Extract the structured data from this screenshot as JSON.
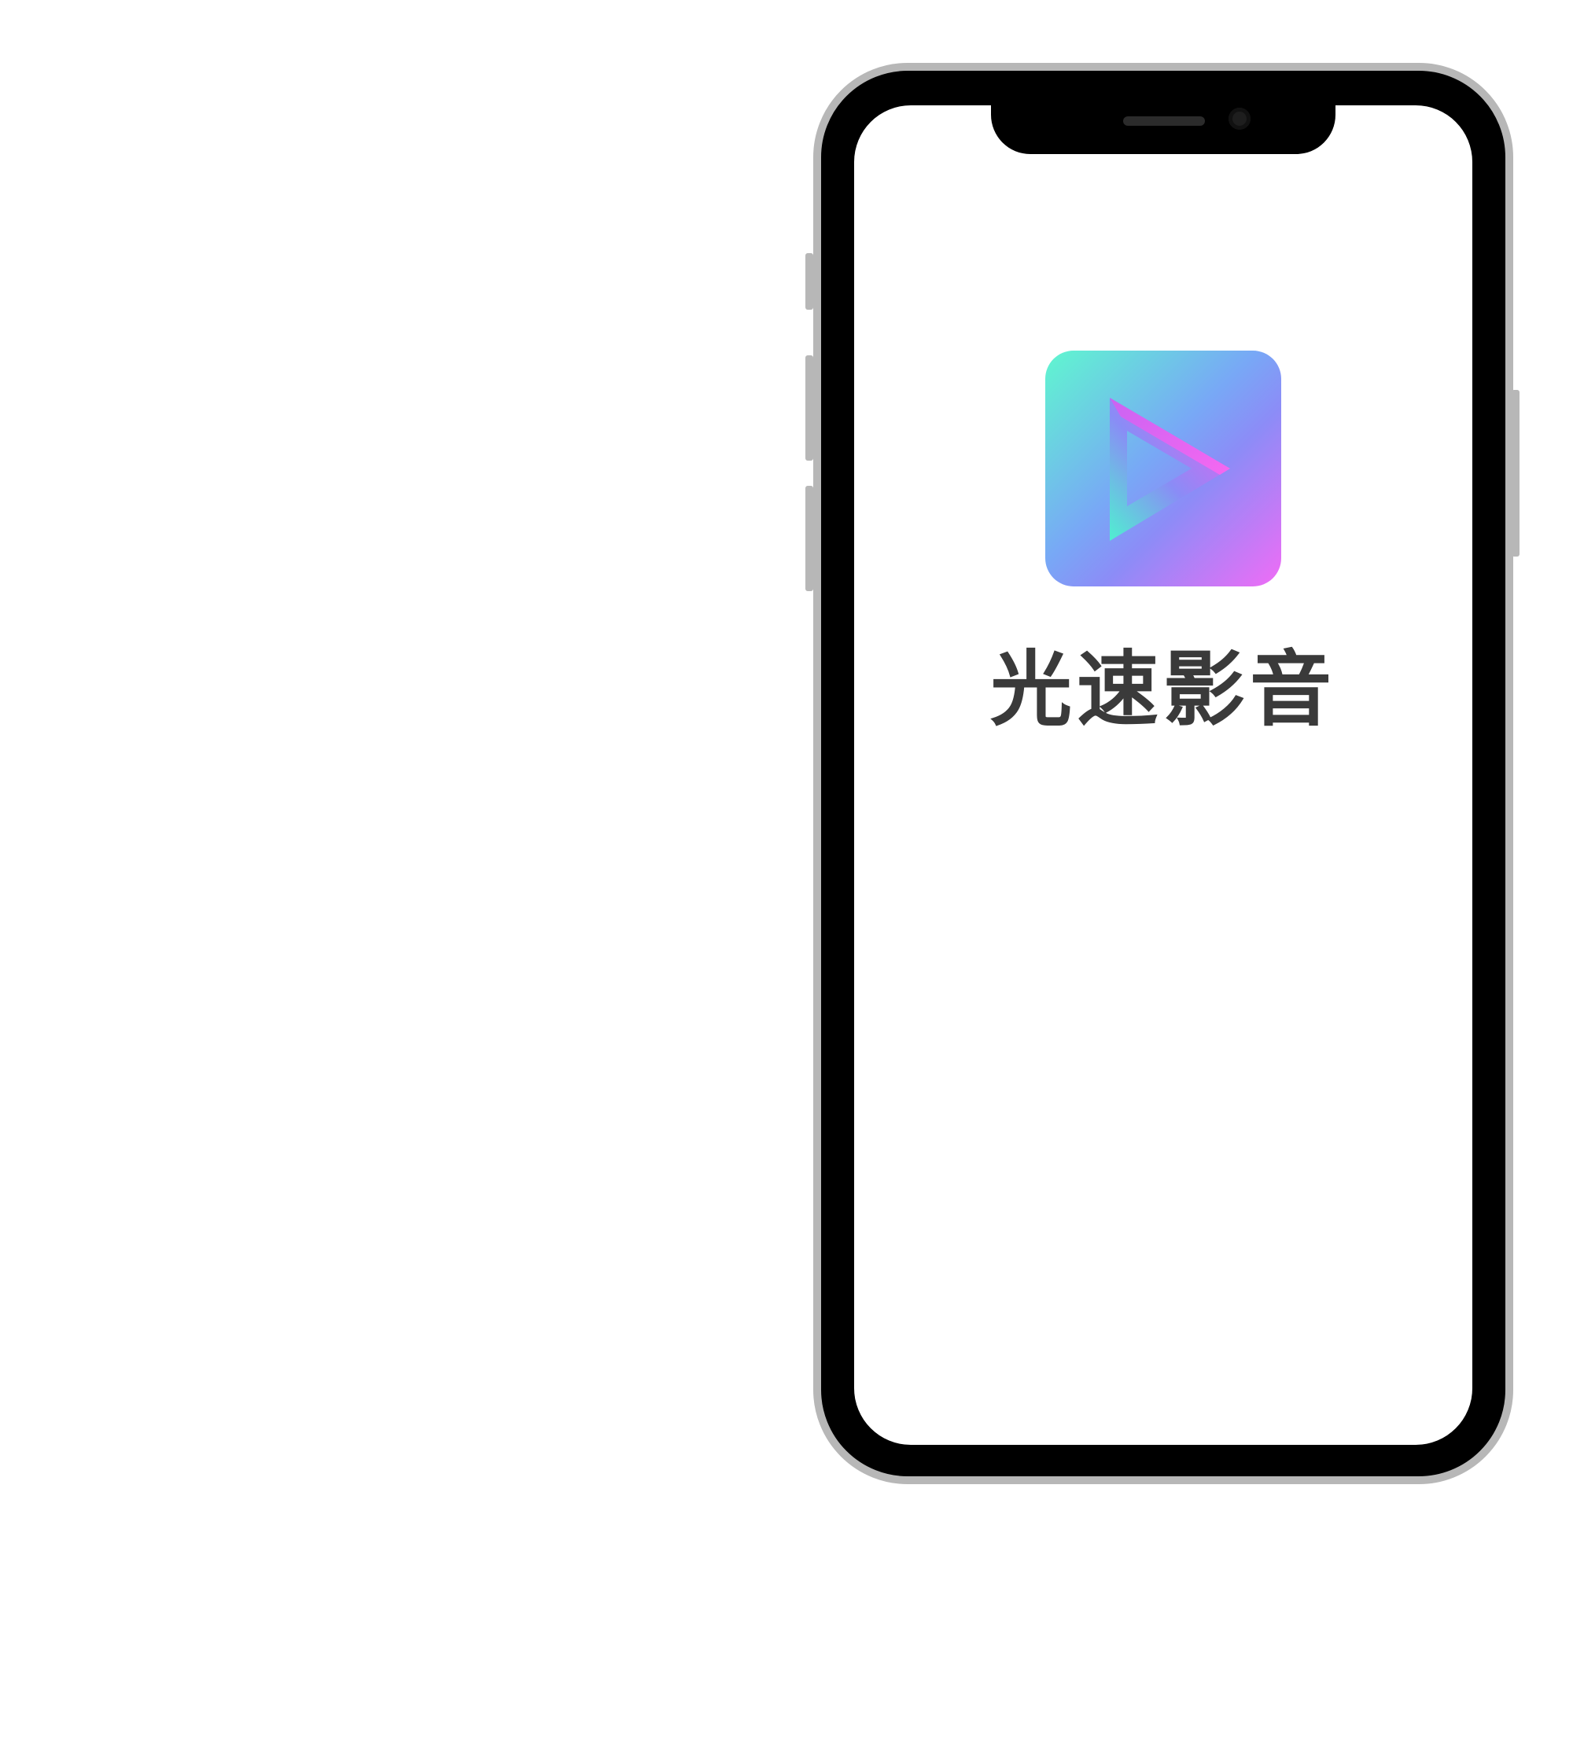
{
  "app": {
    "name": "光速影音",
    "icon": "play-icon"
  },
  "colors": {
    "icon_gradient": [
      "#5ff7cf",
      "#78a8f6",
      "#8c8cf7",
      "#f06cf6"
    ],
    "title_text": "#3a3a3a",
    "phone_bezel": "#000000",
    "phone_frame": "#b7b7b7"
  }
}
